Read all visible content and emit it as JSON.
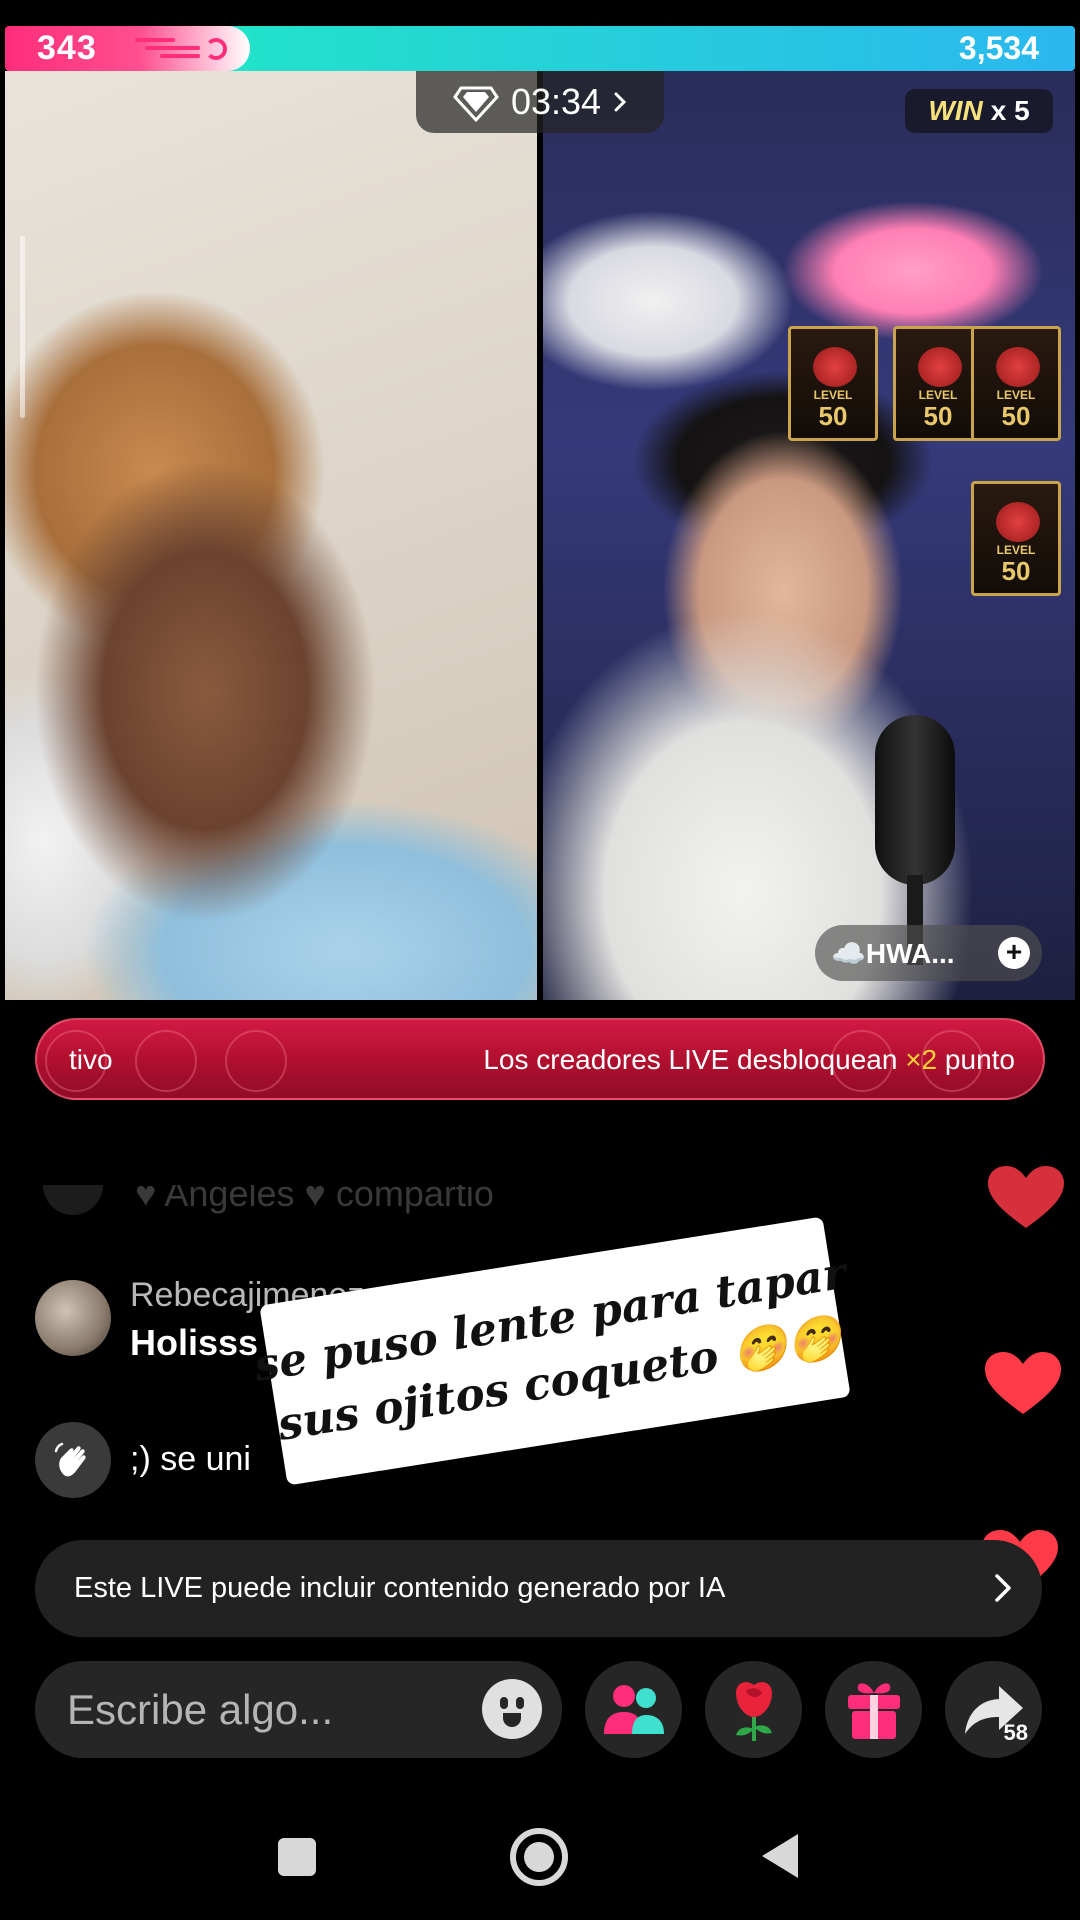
{
  "battle": {
    "left_score": "343",
    "right_score": "3,534",
    "left_color": "#ff2d7a",
    "right_color": "#22e3c9"
  },
  "timer": {
    "time": "03:34",
    "icon": "diamond-icon"
  },
  "win_badge": {
    "win_label": "WIN",
    "multiplier": "x 5"
  },
  "plaques": {
    "label": "LEVEL",
    "value": "50"
  },
  "host_tag": {
    "label": "☁️HWA...",
    "add_symbol": "+"
  },
  "promo": {
    "left_text": "tivo",
    "right_text_before": "Los creadores LIVE desbloquean ",
    "right_text_highlight": "×2",
    "right_text_after": " punto"
  },
  "chat": {
    "faded_line": "♥ Angeles ♥ compartió",
    "messages": [
      {
        "username": "Rebecajimenez",
        "text": "Holisss l"
      },
      {
        "username": "",
        "text": ";) se uni"
      }
    ]
  },
  "caption": {
    "line1": "se puso lente para tapar",
    "line2": "sus ojitos coqueto 🤭🤭"
  },
  "ai_notice": {
    "text": "Este LIVE puede incluir contenido generado por IA"
  },
  "composer": {
    "placeholder": "Escribe algo..."
  },
  "share": {
    "count": "58"
  },
  "colors": {
    "heart": "#ff3b4a",
    "promo": "#c8143c",
    "accent_pink": "#ff2d7a"
  }
}
